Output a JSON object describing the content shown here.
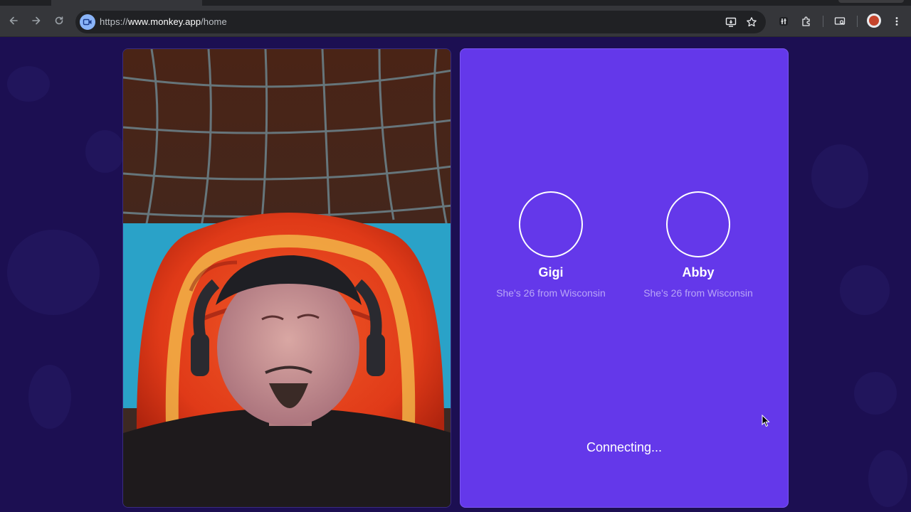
{
  "browser": {
    "url_scheme": "https://",
    "url_host": "www.monkey.app",
    "url_path": "/home"
  },
  "icons": {
    "back": "back-arrow-icon",
    "forward": "forward-arrow-icon",
    "reload": "reload-icon",
    "site": "video-camera-icon",
    "install": "install-app-icon",
    "bookmark": "star-icon",
    "extensions": "puzzle-icon",
    "media": "media-control-icon",
    "profile": "profile-avatar",
    "menu": "kebab-menu-icon"
  },
  "colors": {
    "page_bg": "#1c0f52",
    "panel_bg": "#6438ea",
    "subtext": "#b9a6f7"
  },
  "matches": [
    {
      "name": "Gigi",
      "subtitle": "She's 26 from Wisconsin"
    },
    {
      "name": "Abby",
      "subtitle": "She's 26 from Wisconsin"
    }
  ],
  "status_text": "Connecting..."
}
